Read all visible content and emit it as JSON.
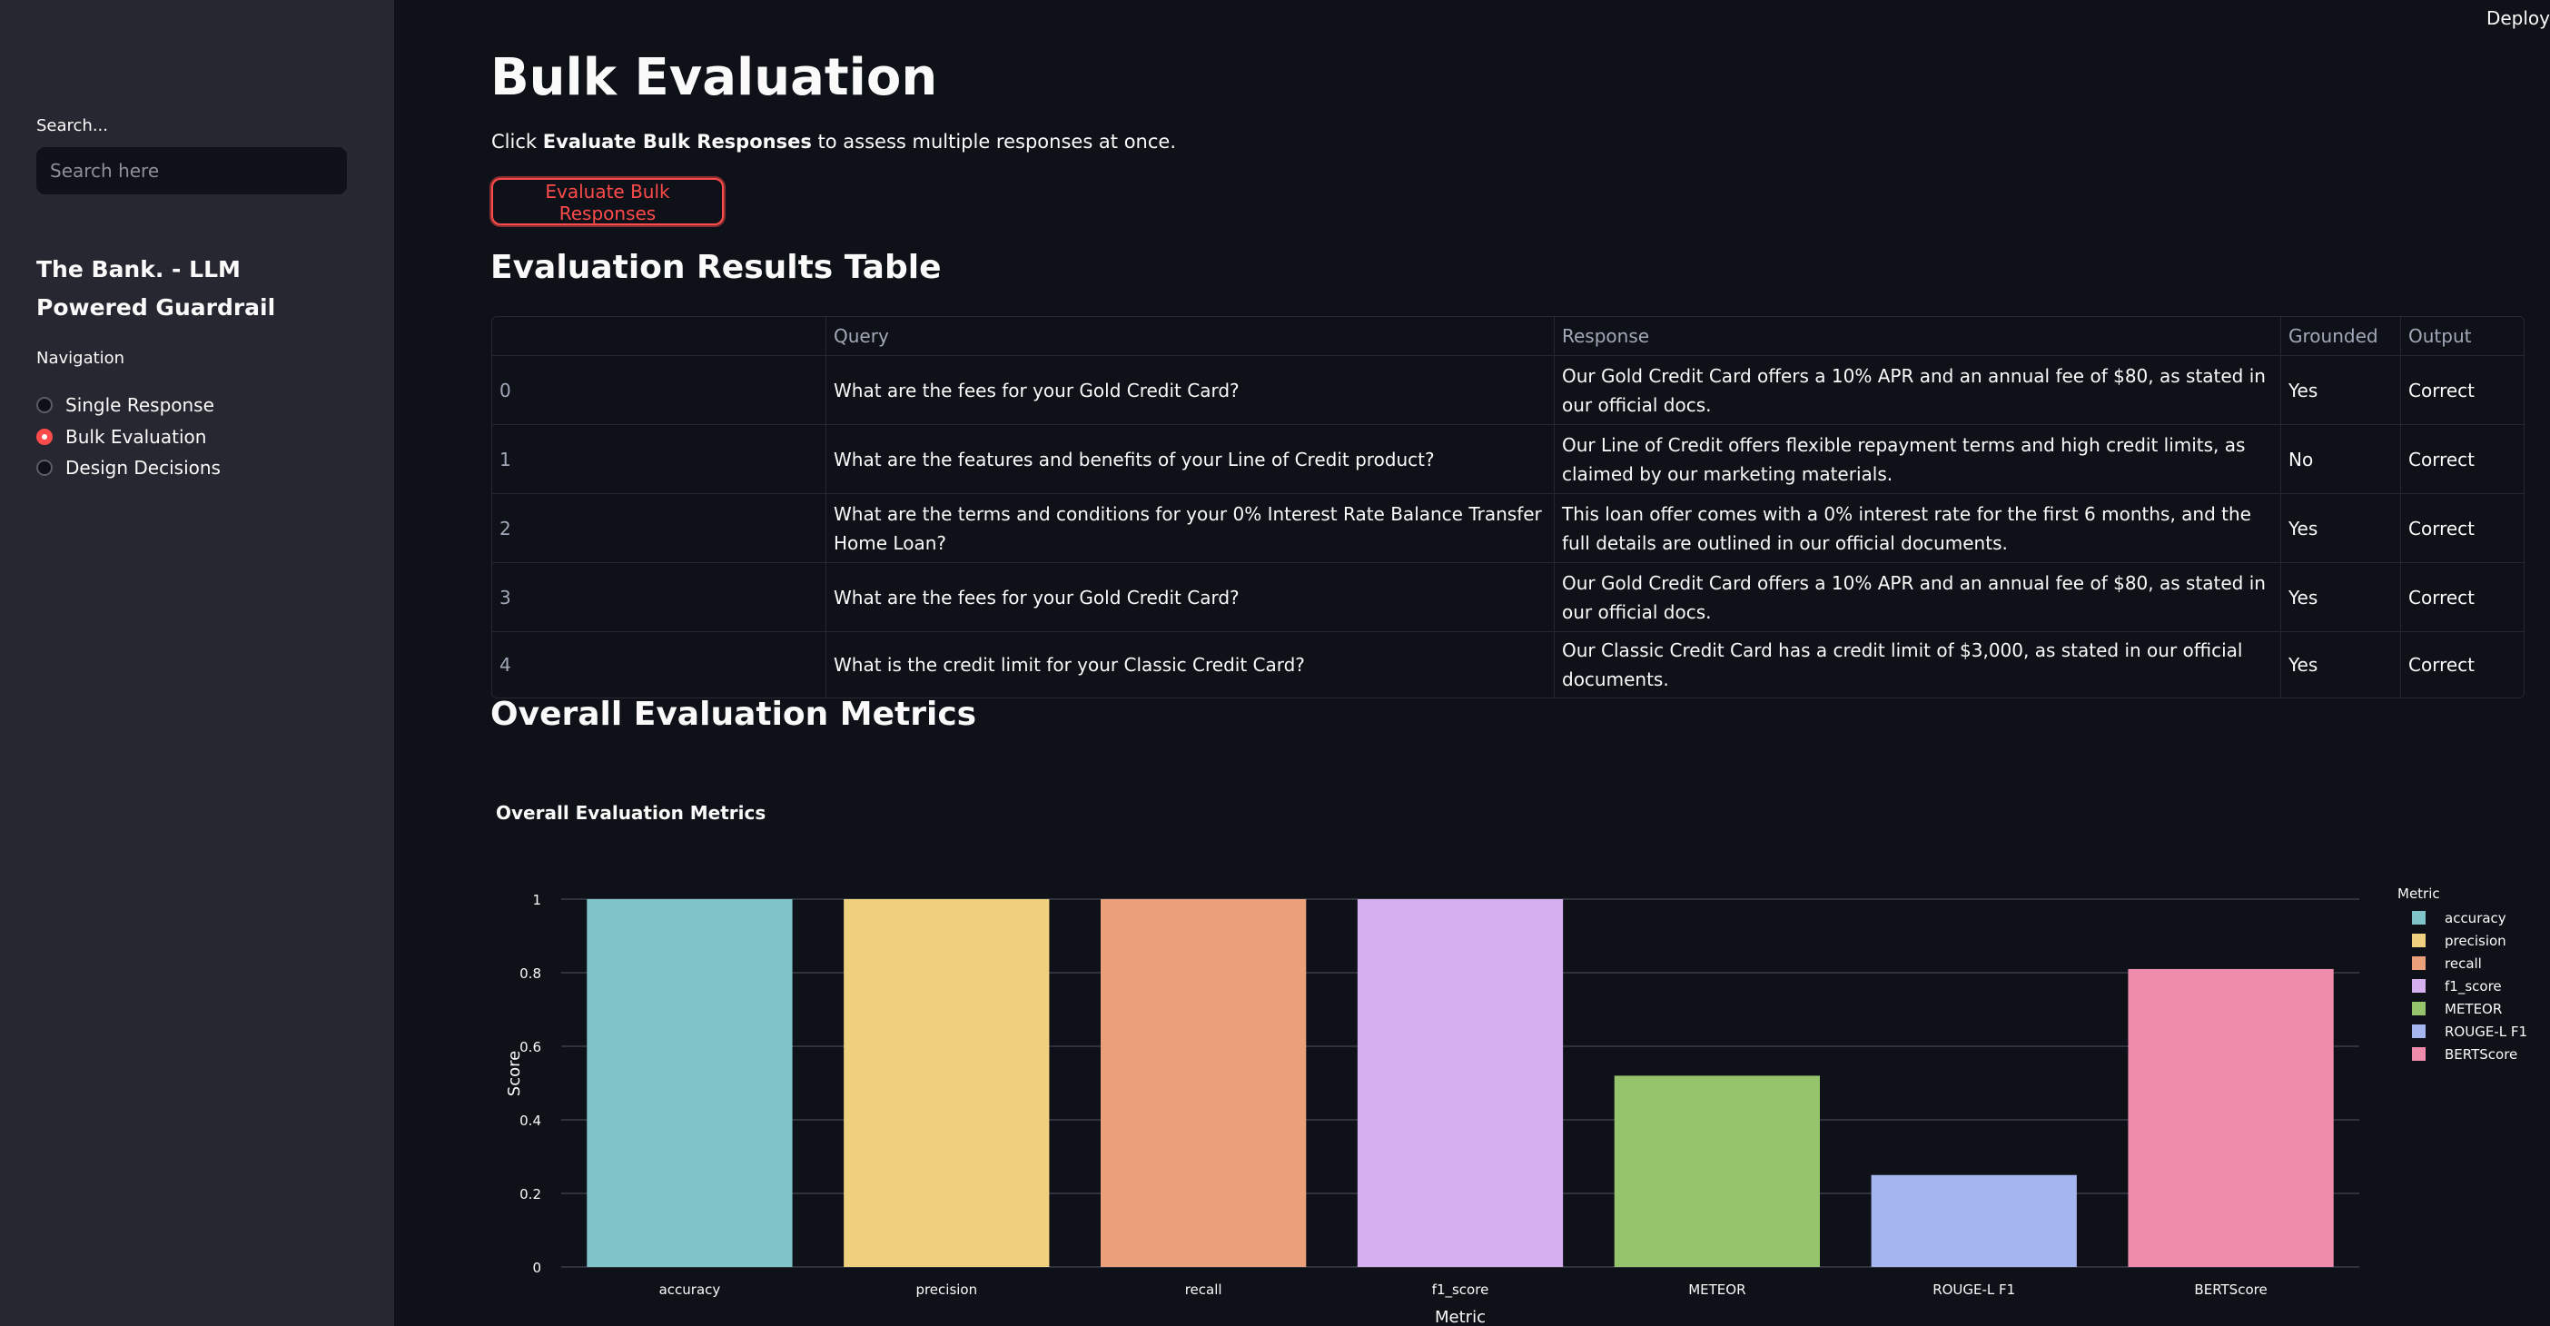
{
  "sidebar": {
    "search_label": "Search...",
    "search_placeholder": "Search here",
    "app_title": "The Bank. - LLM Powered Guardrail",
    "nav_label": "Navigation",
    "nav_items": [
      {
        "label": "Single Response",
        "selected": false
      },
      {
        "label": "Bulk Evaluation",
        "selected": true
      },
      {
        "label": "Design Decisions",
        "selected": false
      }
    ]
  },
  "header": {
    "deploy_label": "Deploy"
  },
  "main": {
    "title": "Bulk Evaluation",
    "intro_prefix": "Click ",
    "intro_bold": "Evaluate Bulk Responses",
    "intro_suffix": " to assess multiple responses at once.",
    "button_label": "Evaluate Bulk Responses",
    "table_heading": "Evaluation Results Table",
    "metrics_heading": "Overall Evaluation Metrics"
  },
  "table": {
    "columns": [
      "",
      "Query",
      "Response",
      "Grounded",
      "Output"
    ],
    "rows": [
      [
        "0",
        "What are the fees for your Gold Credit Card?",
        "Our Gold Credit Card offers a 10% APR and an annual fee of $80, as stated in our official docs.",
        "Yes",
        "Correct"
      ],
      [
        "1",
        "What are the features and benefits of your Line of Credit product?",
        "Our Line of Credit offers flexible repayment terms and high credit limits, as claimed by our marketing materials.",
        "No",
        "Correct"
      ],
      [
        "2",
        "What are the terms and conditions for your 0% Interest Rate Balance Transfer Home Loan?",
        "This loan offer comes with a 0% interest rate for the first 6 months, and the full details are outlined in our official documents.",
        "Yes",
        "Correct"
      ],
      [
        "3",
        "What are the fees for your Gold Credit Card?",
        "Our Gold Credit Card offers a 10% APR and an annual fee of $80, as stated in our official docs.",
        "Yes",
        "Correct"
      ],
      [
        "4",
        "What is the credit limit for your Classic Credit Card?",
        "Our Classic Credit Card has a credit limit of $3,000, as stated in our official documents.",
        "Yes",
        "Correct"
      ]
    ]
  },
  "chart_data": {
    "type": "bar",
    "title": "Overall Evaluation Metrics",
    "xlabel": "Metric",
    "ylabel": "Score",
    "categories": [
      "accuracy",
      "precision",
      "recall",
      "f1_score",
      "METEOR",
      "ROUGE-L F1",
      "BERTScore"
    ],
    "values": [
      1.0,
      1.0,
      1.0,
      1.0,
      0.52,
      0.25,
      0.81
    ],
    "colors": [
      "#7fc4c9",
      "#efd07f",
      "#eba07c",
      "#d6b0ee",
      "#96c46c",
      "#a3b6ef",
      "#ef8cac"
    ],
    "ylim": [
      0,
      1
    ],
    "yticks": [
      "0",
      "0.2",
      "0.4",
      "0.6",
      "0.8",
      "1"
    ],
    "legend_title": "Metric",
    "legend_position": "right",
    "grid": true
  }
}
